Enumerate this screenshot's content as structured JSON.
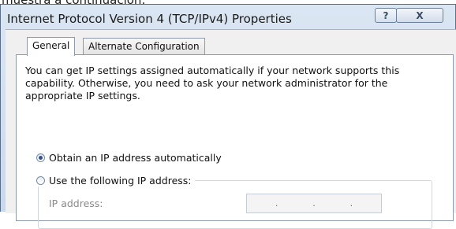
{
  "caption_text": "muestra a continuación:",
  "window": {
    "title": "Internet Protocol Version 4 (TCP/IPv4) Properties"
  },
  "caption_buttons": {
    "help_glyph": "?",
    "close_glyph": "X"
  },
  "tabs": [
    {
      "label": "General",
      "selected": true
    },
    {
      "label": "Alternate Configuration",
      "selected": false
    }
  ],
  "general": {
    "intro": "You can get IP settings assigned automatically if your network supports this capability. Otherwise, you need to ask your network administrator for the appropriate IP settings.",
    "obtain_auto_label": "Obtain an IP address automatically",
    "obtain_auto_selected": true,
    "use_following_label": "Use the following IP address:",
    "use_following_selected": false,
    "ip_label": "IP address:",
    "ip_dots": [
      ".",
      ".",
      "."
    ]
  }
}
